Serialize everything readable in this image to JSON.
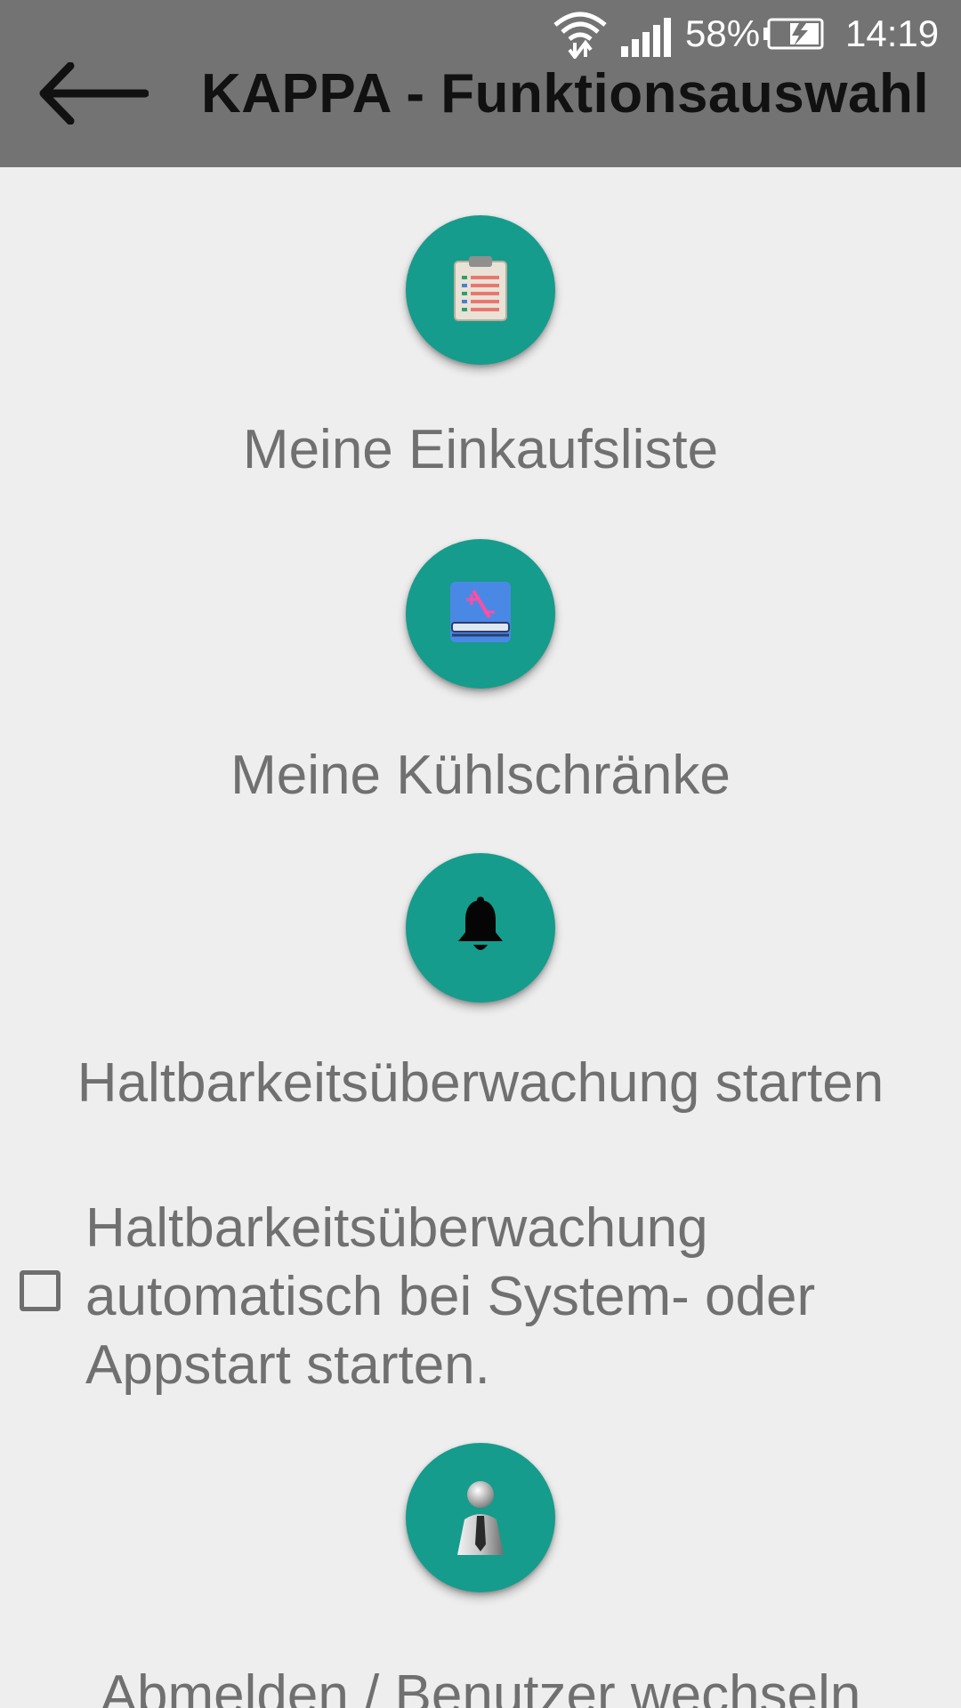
{
  "status_bar": {
    "battery_percent": "58%",
    "time": "14:19"
  },
  "toolbar": {
    "title": "KAPPA - Funktionsauswahl",
    "back_icon": "arrow-left-icon"
  },
  "menu": {
    "items": [
      {
        "label": "Meine Einkaufsliste",
        "icon": "clipboard-list-icon"
      },
      {
        "label": "Meine Kühlschränke",
        "icon": "fridge-book-icon"
      },
      {
        "label": "Haltbarkeitsüberwachung starten",
        "icon": "bell-icon"
      },
      {
        "label": "Abmelden / Benutzer wechseln",
        "icon": "user-tie-icon"
      }
    ],
    "autostart_checkbox": {
      "label": "Haltbarkeitsüberwachung automatisch bei System- oder Appstart starten.",
      "checked": false
    }
  },
  "colors": {
    "toolbar_bg": "#737373",
    "fab_bg": "#159c8c",
    "page_bg": "#eeeeee",
    "label_text": "#707070"
  }
}
